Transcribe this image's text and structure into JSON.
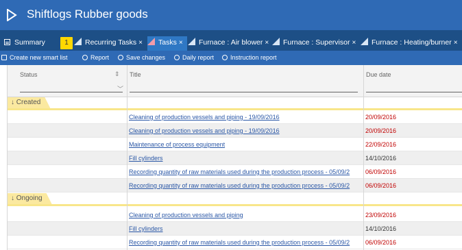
{
  "app": {
    "title": "Shiftlogs Rubber goods",
    "brand_color": "#2f6ab5"
  },
  "tabs": [
    {
      "label": "Summary",
      "icon": "summary-icon"
    },
    {
      "label": "Recurring Tasks",
      "close": "×"
    },
    {
      "label": "Tasks",
      "close": "×",
      "active": true
    },
    {
      "label": "Furnace : Air blower",
      "close": "×"
    },
    {
      "label": "Furnace : Supervisor",
      "close": "×"
    },
    {
      "label": "Furnace : Heating/burner",
      "close": "×"
    }
  ],
  "badge": "1",
  "toolbar": [
    {
      "label": "Create new smart list",
      "icon": "list-icon"
    },
    {
      "label": "Report",
      "icon": "bell-icon"
    },
    {
      "label": "Save changes",
      "icon": "gear-icon"
    },
    {
      "label": "Daily report",
      "icon": "gear-icon"
    },
    {
      "label": "Instruction report",
      "icon": "gear-icon"
    }
  ],
  "columns": {
    "status": "Status",
    "title": "Title",
    "due": "Due date"
  },
  "groups": [
    {
      "label": "Created",
      "arrow": "↓",
      "rows": [
        {
          "title": "Cleaning of production vessels and piping - 19/09/2016",
          "due": "20/09/2016",
          "late": true
        },
        {
          "title": "Cleaning of production vessels and piping - 19/09/2016",
          "due": "20/09/2016",
          "late": true
        },
        {
          "title": "Maintenance of process equipment",
          "due": "22/09/2016",
          "late": true
        },
        {
          "title": "Fill cylinders",
          "due": "14/10/2016",
          "late": false
        },
        {
          "title": "Recording quantity of raw materials used during the production process - 05/09/2",
          "due": "06/09/2016",
          "late": true
        },
        {
          "title": "Recording quantity of raw materials used during the production process - 05/09/2",
          "due": "06/09/2016",
          "late": true
        }
      ]
    },
    {
      "label": "Ongoing",
      "arrow": "↓",
      "rows": [
        {
          "title": "Cleaning of production vessels and piping",
          "due": "23/09/2016",
          "late": true
        },
        {
          "title": "Fill cylinders",
          "due": "14/10/2016",
          "late": false
        },
        {
          "title": "Recording quantity of raw materials used during the production process - 05/09/2",
          "due": "06/09/2016",
          "late": true
        }
      ]
    }
  ],
  "colors": {
    "late": "#c00000",
    "link": "#2a57a6",
    "group": "#fbe9a0"
  }
}
